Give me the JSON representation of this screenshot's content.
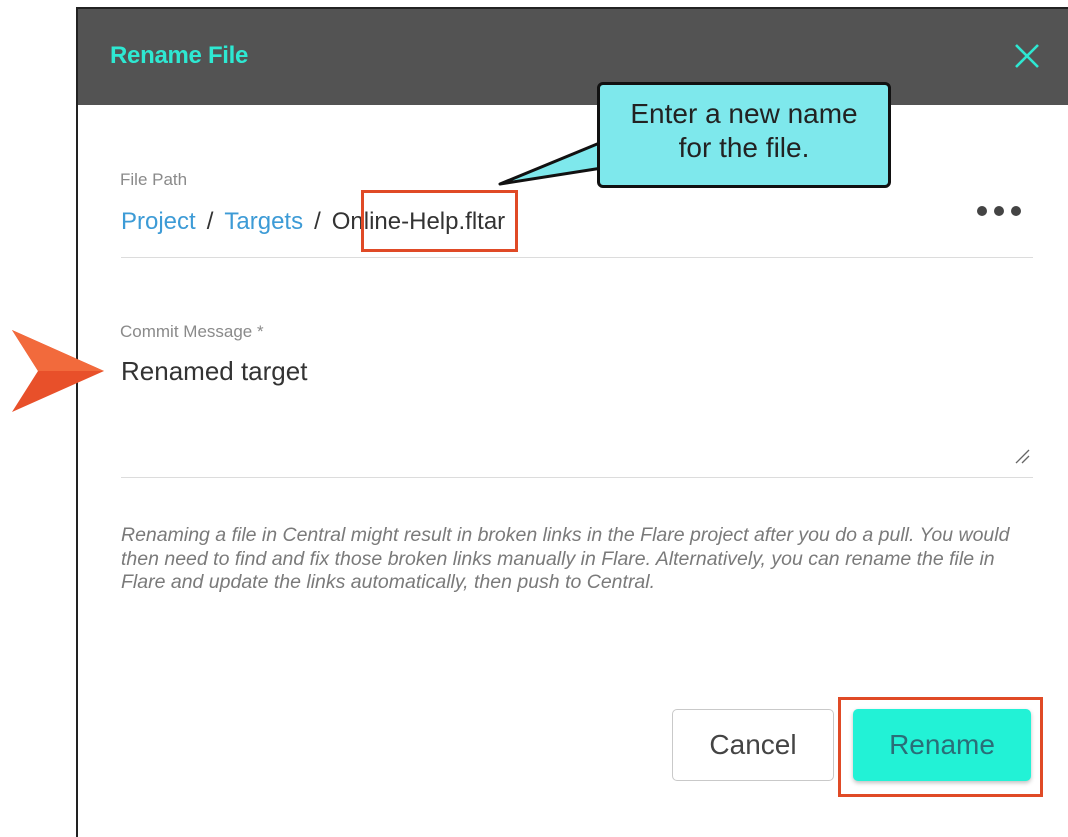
{
  "dialog": {
    "title": "Rename File",
    "close_icon": "close-icon"
  },
  "file_path": {
    "label": "File Path",
    "crumbs": [
      "Project",
      "Targets"
    ],
    "separator": "/",
    "current_file": "Online-Help.fltar",
    "more_icon": "more-horizontal-icon"
  },
  "commit": {
    "label": "Commit Message *",
    "value": "Renamed target"
  },
  "warning": "Renaming a file in Central might result in broken links in the Flare project after you do a pull. You would then need to find and fix those broken links manually in Flare. Alternatively, you can rename the file in Flare and update the links automatically, then push to Central.",
  "buttons": {
    "cancel": "Cancel",
    "rename": "Rename"
  },
  "annotations": {
    "callout_line1": "Enter a new name",
    "callout_line2": "for the file.",
    "pointer_icon": "arrow-right-icon",
    "highlight_color": "#e04a26"
  },
  "colors": {
    "header_bg": "#535353",
    "title_accent": "#2ee8d2",
    "link": "#3d9bd6",
    "primary_button": "#22f2d6",
    "callout_bg": "#7ee8ec"
  }
}
